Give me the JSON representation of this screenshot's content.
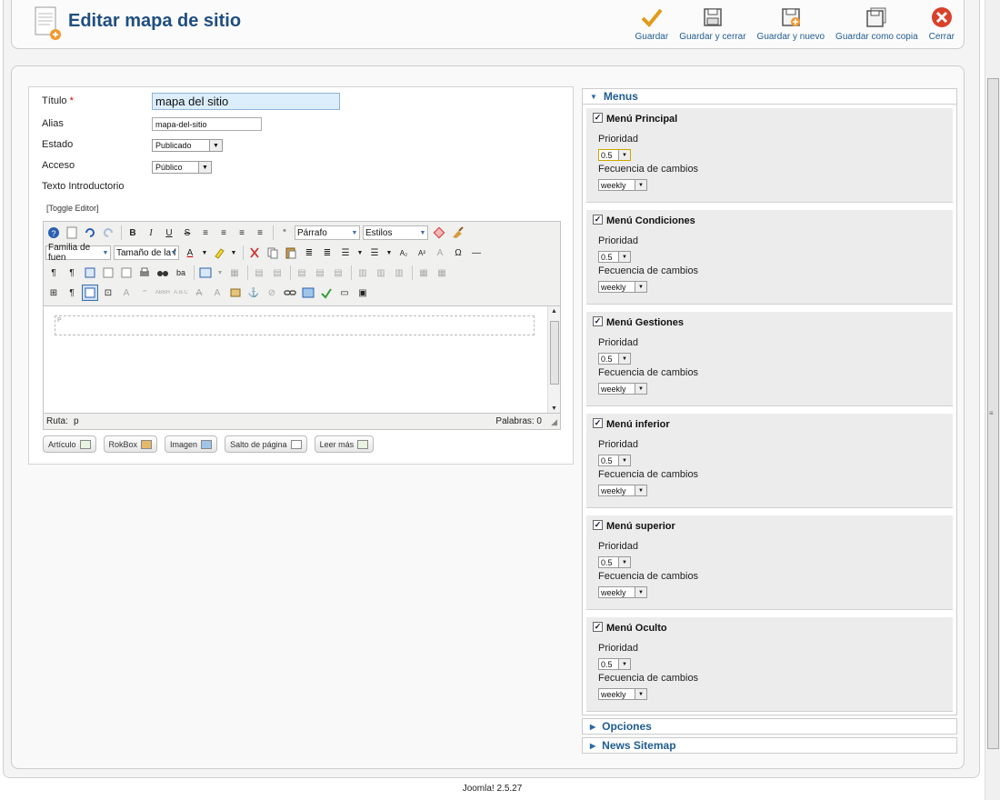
{
  "header": {
    "title": "Editar mapa de sitio",
    "toolbar": [
      {
        "label": "Guardar",
        "icon": "checkmark-icon"
      },
      {
        "label": "Guardar y cerrar",
        "icon": "floppy-icon"
      },
      {
        "label": "Guardar y nuevo",
        "icon": "floppy-new-icon"
      },
      {
        "label": "Guardar como copia",
        "icon": "floppy-copy-icon"
      },
      {
        "label": "Cerrar",
        "icon": "close-icon"
      }
    ]
  },
  "form": {
    "title_label": "Título",
    "required_mark": "*",
    "title_value": "mapa del sitio",
    "alias_label": "Alias",
    "alias_value": "mapa-del-sitio",
    "state_label": "Estado",
    "state_value": "Publicado",
    "access_label": "Acceso",
    "access_value": "Público",
    "intro_label": "Texto Introductorio"
  },
  "editor": {
    "toggle_label": "[Toggle Editor]",
    "format_value": "Párrafo",
    "styles_value": "Estilos",
    "font_family_value": "Familia de fuen",
    "font_size_value": "Tamaño de la f",
    "body_marker": "P",
    "path_label": "Ruta:",
    "path_value": "p",
    "words_label": "Palabras: 0",
    "buttons": [
      "Artículo",
      "RokBox",
      "Imagen",
      "Salto de página",
      "Leer más"
    ]
  },
  "panels": {
    "menus_title": "Menus",
    "options_title": "Opciones",
    "news_title": "News Sitemap",
    "priority_label": "Prioridad",
    "frequency_label": "Fecuencia de cambios",
    "menus": [
      {
        "name": "Menú Principal",
        "priority": "0.5",
        "frequency": "weekly",
        "checked": true
      },
      {
        "name": "Menú Condiciones",
        "priority": "0.5",
        "frequency": "weekly",
        "checked": true
      },
      {
        "name": "Menú Gestiones",
        "priority": "0.5",
        "frequency": "weekly",
        "checked": true
      },
      {
        "name": "Menú inferior",
        "priority": "0.5",
        "frequency": "weekly",
        "checked": true
      },
      {
        "name": "Menú superior",
        "priority": "0.5",
        "frequency": "weekly",
        "checked": true
      },
      {
        "name": "Menú Oculto",
        "priority": "0.5",
        "frequency": "weekly",
        "checked": true
      }
    ]
  },
  "footer": {
    "text": "Joomla! 2.5.27"
  },
  "colors": {
    "title": "#1f4f7f",
    "link": "#1f5c91",
    "save_check": "#e39a1a",
    "close_red": "#d9412b"
  }
}
